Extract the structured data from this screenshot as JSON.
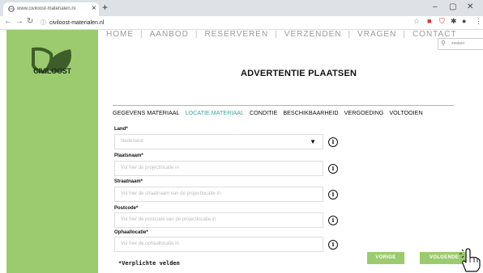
{
  "browser": {
    "tab_title": "www.civiloost-materialen.nl",
    "url": "civiloost-materialen.nl"
  },
  "brand": {
    "name": "CIVILOOST"
  },
  "nav": {
    "items": [
      "HOME",
      "AANBOD",
      "RESERVEREN",
      "VERZENDEN",
      "VRAGEN",
      "CONTACT"
    ],
    "search_value": "zoeken"
  },
  "page": {
    "title": "ADVERTENTIE PLAATSEN"
  },
  "steps": [
    {
      "label": "GEGEVENS MATERIAAL",
      "active": false
    },
    {
      "label": "LOCATIE MATERIAAL",
      "active": true
    },
    {
      "label": "CONDITIE",
      "active": false
    },
    {
      "label": "BESCHIKBAARHEID",
      "active": false
    },
    {
      "label": "VERGOEDING",
      "active": false
    },
    {
      "label": "VOLTOOIEN",
      "active": false
    }
  ],
  "form": {
    "land_label": "Land*",
    "land_value": "Nederland",
    "plaatsnaam_label": "Plaatsnaam*",
    "plaatsnaam_placeholder": "Vul hier de projectlocatie in",
    "straatnaam_label": "Straatnaam*",
    "straatnaam_placeholder": "Vul hier de straatnaam van de projectlocatie in",
    "postcode_label": "Postcode*",
    "postcode_placeholder": "Vul hier de postcode van de projectlocatie in",
    "ophaallocatie_label": "Ophaallocatie*",
    "ophaallocatie_placeholder": "Vul hier de ophaallocatie in",
    "required_note": "*Verplichte velden"
  },
  "buttons": {
    "prev": "VORIGE",
    "next": "VOLGENDE"
  },
  "colors": {
    "brand_green": "#9bcb6e",
    "active_step": "#3aa89b"
  }
}
